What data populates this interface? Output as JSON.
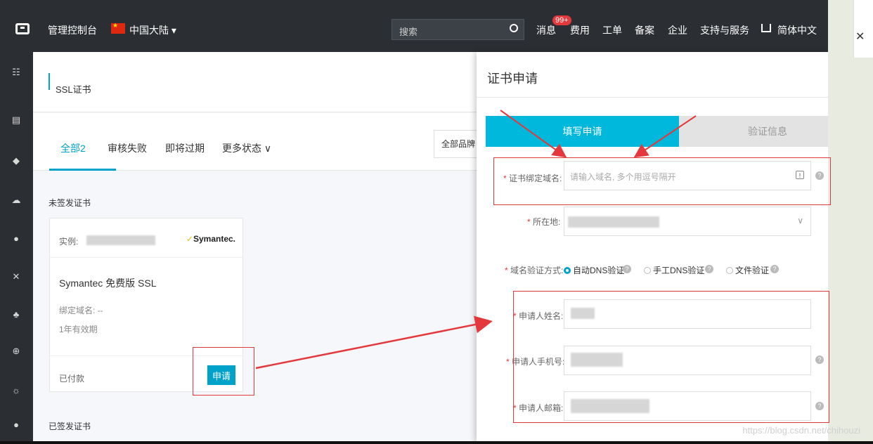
{
  "topbar": {
    "console": "管理控制台",
    "region": "中国大陆 ▾",
    "search_placeholder": "搜索",
    "badge": "99+",
    "nav": [
      "消息",
      "费用",
      "工单",
      "备案",
      "企业",
      "支持与服务"
    ],
    "lang": "简体中文"
  },
  "page": {
    "title": "SSL证书",
    "tabs": [
      "全部",
      "审核失败",
      "即将过期",
      "更多状态 ∨"
    ],
    "all_count": "2",
    "brand_filter": "全部品牌",
    "unissued": "未签发证书",
    "issued": "已签发证书"
  },
  "card": {
    "instance_label": "实例: ",
    "brand": "Symantec.",
    "product": "Symantec 免费版 SSL",
    "domain": "绑定域名: --",
    "validity": "1年有效期",
    "status": "已付款",
    "apply": "申请"
  },
  "drawer": {
    "title": "证书申请",
    "step1": "填写申请",
    "step2": "验证信息",
    "domain_label": "证书绑定域名:",
    "domain_placeholder": "请输入域名, 多个用逗号隔开",
    "location_label": "所在地:",
    "verify_label": "域名验证方式:",
    "verify_options": [
      "自动DNS验证",
      "手工DNS验证",
      "文件验证"
    ],
    "name_label": "申请人姓名:",
    "phone_label": "申请人手机号:",
    "email_label": "申请人邮箱:"
  },
  "watermark": "https://blog.csdn.net/chihouzi",
  "colors": {
    "accent": "#00a2ca",
    "topbar": "#2b2e33",
    "annotation": "#e4393c"
  }
}
